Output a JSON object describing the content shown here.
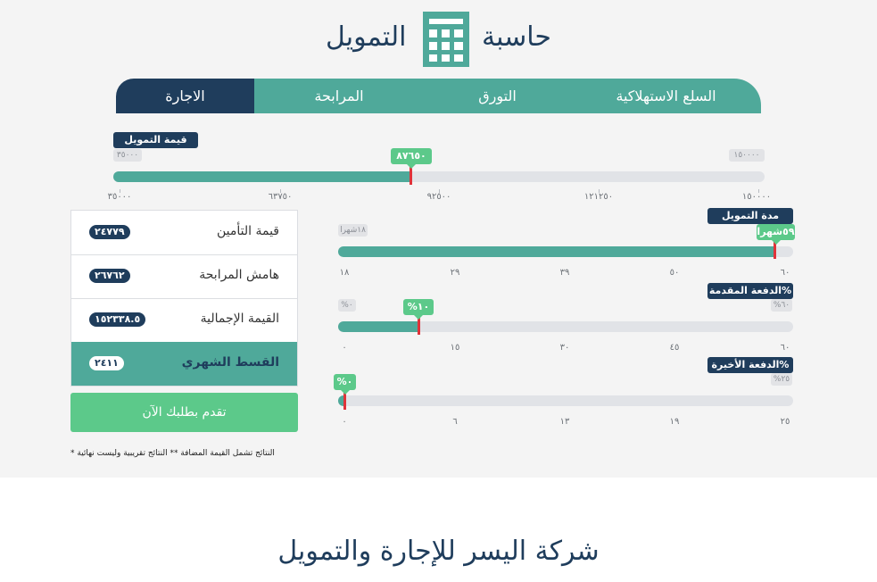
{
  "header": {
    "title_part1": "حاسبة",
    "title_part2": "التمويل",
    "icon": "calculator-icon"
  },
  "tabs": [
    {
      "label": "السلع الاستهلاكية",
      "active": false
    },
    {
      "label": "التورق",
      "active": false
    },
    {
      "label": "المرابحة",
      "active": false
    },
    {
      "label": "الاجارة",
      "active": true
    }
  ],
  "financing_amount": {
    "label": "قيمة التمويل",
    "min_label": "٣٥٠٠٠",
    "max_label": "١٥٠٠٠٠",
    "value_label": "٨٧٦٥٠",
    "value": 87650,
    "min": 35000,
    "max": 150000,
    "ticks": [
      "٣٥٠٠٠",
      "٦٣٧٥٠",
      "٩٢٥٠٠",
      "١٢١٢٥٠",
      "١٥٠٠٠٠"
    ]
  },
  "duration": {
    "label": "مدة التمويل",
    "min_label": "١٨شهرا",
    "value_label": "٥٩شهرا",
    "value": 59,
    "min": 18,
    "max": 60,
    "ticks": [
      "١٨",
      "٢٩",
      "٣٩",
      "٥٠",
      "٦٠"
    ]
  },
  "down_payment": {
    "label": "الدفعة المقدمة%",
    "min_label": "%٠",
    "max_label": "%٦٠",
    "value_label": "%١٠",
    "value": 10,
    "min": 0,
    "max": 60,
    "ticks": [
      "٠",
      "١٥",
      "٣٠",
      "٤٥",
      "٦٠"
    ]
  },
  "balloon_payment": {
    "label": "الدفعة الأخيرة%",
    "max_label": "%٢٥",
    "value_label": "%٠",
    "value": 0,
    "min": 0,
    "max": 25,
    "ticks": [
      "٠",
      "٦",
      "١٣",
      "١٩",
      "٢٥"
    ]
  },
  "results": {
    "insurance_label": "قيمة التأمين",
    "insurance_value": "٢٤٧٧٩",
    "margin_label": "هامش المرابحة",
    "margin_value": "٢٦٧٦٢",
    "total_label": "القيمة الإجمالية",
    "total_value": "١٥٢٣٣٨.٥",
    "monthly_label": "القسط الشهري",
    "monthly_value": "٢٤١١"
  },
  "apply_button": "تقدم بطلبك الآن",
  "notes": "*   النتائج تشمل القيمة المضافة   **   النتائج تقريبية وليست نهائية",
  "company_name": "شركة اليسر للإجارة والتمويل",
  "colors": {
    "navy": "#1f3d5c",
    "teal": "#4fa99a",
    "green": "#5cc98a",
    "handle_red": "#e0333a"
  }
}
